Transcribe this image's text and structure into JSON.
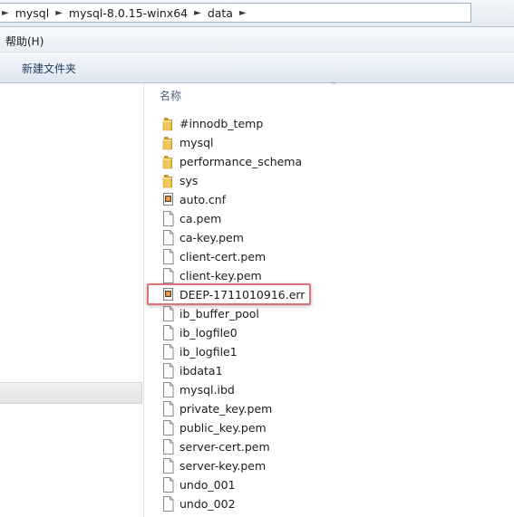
{
  "breadcrumb": {
    "items": [
      "mysql",
      "mysql-8.0.15-winx64",
      "data"
    ],
    "separator": "►"
  },
  "menu": {
    "help_label": "帮助(H)"
  },
  "toolbar": {
    "new_folder_label": "新建文件夹"
  },
  "file_list": {
    "column_name": "名称",
    "sort_indicator": "^",
    "files": [
      {
        "name": "#innodb_temp",
        "icon": "folder-icon"
      },
      {
        "name": "mysql",
        "icon": "folder-icon"
      },
      {
        "name": "performance_schema",
        "icon": "folder-icon"
      },
      {
        "name": "sys",
        "icon": "folder-icon"
      },
      {
        "name": "auto.cnf",
        "icon": "config-file-icon"
      },
      {
        "name": "ca.pem",
        "icon": "file-icon"
      },
      {
        "name": "ca-key.pem",
        "icon": "file-icon"
      },
      {
        "name": "client-cert.pem",
        "icon": "file-icon"
      },
      {
        "name": "client-key.pem",
        "icon": "file-icon"
      },
      {
        "name": "DEEP-1711010916.err",
        "icon": "config-file-icon"
      },
      {
        "name": "ib_buffer_pool",
        "icon": "file-icon"
      },
      {
        "name": "ib_logfile0",
        "icon": "file-icon"
      },
      {
        "name": "ib_logfile1",
        "icon": "file-icon"
      },
      {
        "name": "ibdata1",
        "icon": "file-icon"
      },
      {
        "name": "mysql.ibd",
        "icon": "file-icon"
      },
      {
        "name": "private_key.pem",
        "icon": "file-icon"
      },
      {
        "name": "public_key.pem",
        "icon": "file-icon"
      },
      {
        "name": "server-cert.pem",
        "icon": "file-icon"
      },
      {
        "name": "server-key.pem",
        "icon": "file-icon"
      },
      {
        "name": "undo_001",
        "icon": "file-icon"
      },
      {
        "name": "undo_002",
        "icon": "file-icon"
      }
    ]
  },
  "colors": {
    "highlight_border": "#e0707a",
    "folder": "#e8b84a"
  }
}
